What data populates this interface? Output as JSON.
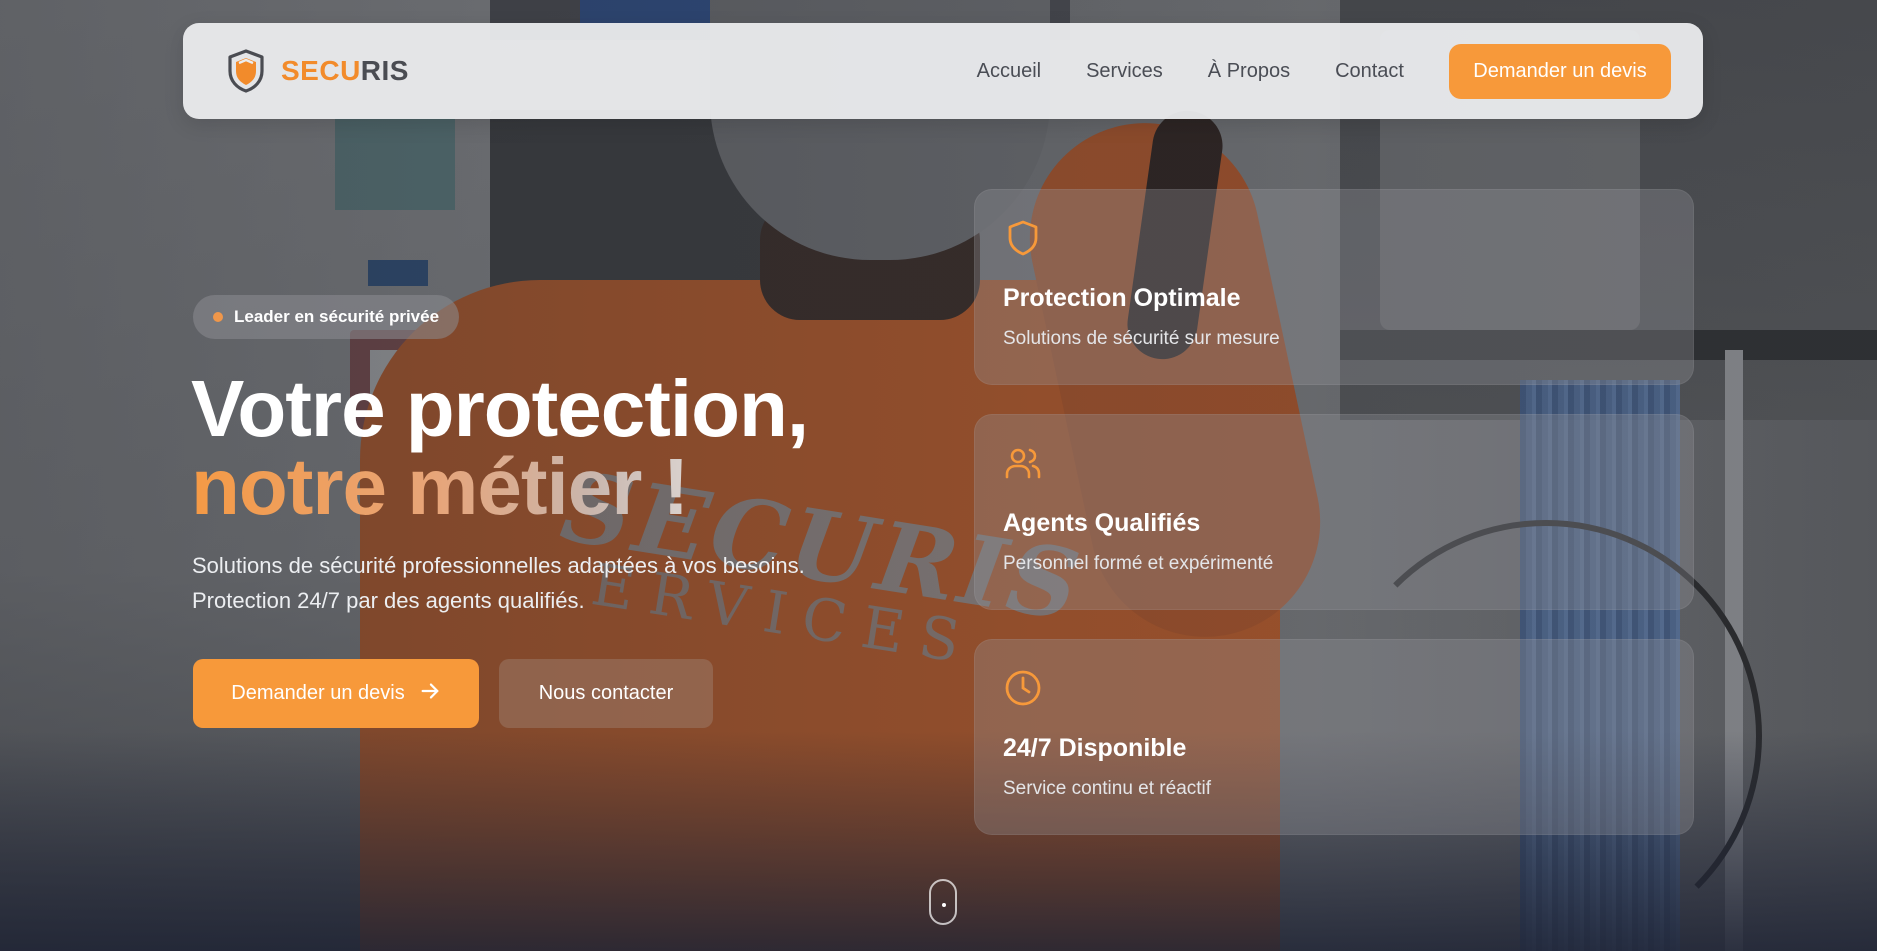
{
  "brand": {
    "name_part1": "SECU",
    "name_part2": "RIS"
  },
  "nav": {
    "links": [
      "Accueil",
      "Services",
      "À Propos",
      "Contact"
    ],
    "cta": "Demander un devis"
  },
  "hero": {
    "badge": "Leader en sécurité privée",
    "title_line1": "Votre protection,",
    "title_line2": "notre métier !",
    "subtitle": "Solutions de sécurité professionnelles adaptées à vos besoins. Protection 24/7 par des agents qualifiés.",
    "primary_button": "Demander un devis",
    "secondary_button": "Nous contacter"
  },
  "features": [
    {
      "icon": "shield-icon",
      "title": "Protection Optimale",
      "description": "Solutions de sécurité sur mesure"
    },
    {
      "icon": "users-icon",
      "title": "Agents Qualifiés",
      "description": "Personnel formé et expérimenté"
    },
    {
      "icon": "clock-icon",
      "title": "24/7 Disponible",
      "description": "Service continu et réactif"
    }
  ],
  "colors": {
    "accent": "#f7993a",
    "nav_bg": "#ecedef",
    "text_dark": "#4a4d55"
  }
}
